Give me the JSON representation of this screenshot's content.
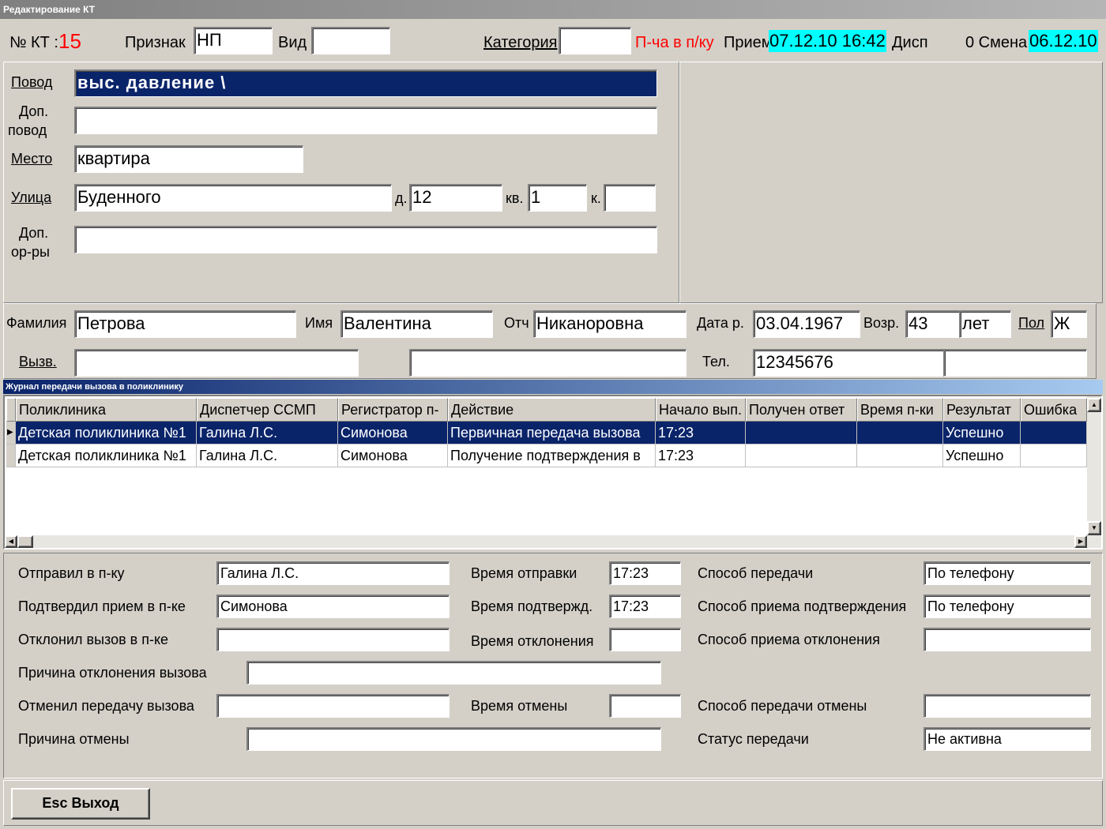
{
  "window": {
    "title": "Редактирование КТ"
  },
  "header": {
    "kt_label": "№ КТ :",
    "kt_number": "15",
    "priznak_label": "Признак",
    "priznak_value": "НП",
    "vid_label": "Вид",
    "vid_value": "",
    "kategoriya_label": "Категория",
    "kategoriya_value": "",
    "pcha_label": "П-ча в п/ку",
    "priem_label": "Прием",
    "priem_value": "07.12.10 16:42",
    "disp_label": "Дисп",
    "smena_label": "0 Смена",
    "smena_value": "06.12.10"
  },
  "address": {
    "povod_label": "Повод",
    "povod_value": "выс. давление  \\",
    "dop_povod_label_1": "Доп.",
    "dop_povod_label_2": "повод",
    "dop_povod_value": "",
    "mesto_label": "Место",
    "mesto_value": "квартира",
    "ulica_label": "Улица",
    "ulica_value": "Буденного",
    "d_label": "д.",
    "d_value": "12",
    "kv_label": "кв.",
    "kv_value": "1",
    "k_label": "к.",
    "k_value": "",
    "dop_ory_label_1": "Доп.",
    "dop_ory_label_2": "ор-ры",
    "dop_ory_value": ""
  },
  "patient": {
    "familiya_label": "Фамилия",
    "familiya_value": "Петрова",
    "imya_label": "Имя",
    "imya_value": "Валентина",
    "otch_label": "Отч",
    "otch_value": "Никаноровна",
    "data_r_label": "Дата р.",
    "data_r_value": "03.04.1967",
    "vozr_label": "Возр.",
    "vozr_value": "43",
    "vozr_unit": "лет",
    "pol_label": "Пол",
    "pol_value": "Ж",
    "vyzv_label": "Вызв.",
    "vyzv_value": "",
    "vyzv_value2": "",
    "tel_label": "Тел.",
    "tel_value": "12345676",
    "tel_value2": ""
  },
  "journal": {
    "title": "Журнал передачи вызова в поликлинику",
    "columns": [
      "Поликлиника",
      "Диспетчер ССМП",
      "Регистратор п-",
      "Действие",
      "Начало вып.",
      "Получен ответ",
      "Время п-ки",
      "Результат",
      "Ошибка"
    ],
    "rows": [
      [
        "Детская поликлиника №1",
        "Галина Л.С.",
        "Симонова",
        "Первичная передача вызова",
        "17:23",
        "",
        "",
        "Успешно",
        ""
      ],
      [
        "Детская поликлиника №1",
        "Галина Л.С.",
        "Симонова",
        "Получение подтверждения в",
        "17:23",
        "",
        "",
        "Успешно",
        ""
      ]
    ]
  },
  "details": {
    "otpravil_label": "Отправил в п-ку",
    "otpravil_value": "Галина Л.С.",
    "vremya_otpr_label": "Время отправки",
    "vremya_otpr_value": "17:23",
    "sposob_per_label": "Способ передачи",
    "sposob_per_value": "По телефону",
    "podtverdil_label": "Подтвердил прием в п-ке",
    "podtverdil_value": "Симонова",
    "vremya_podtv_label": "Время подтвержд.",
    "vremya_podtv_value": "17:23",
    "sposob_podtv_label": "Способ приема подтверждения",
    "sposob_podtv_value": "По телефону",
    "otklonil_label": "Отклонил вызов в п-ке",
    "otklonil_value": "",
    "vremya_otkl_label": "Время отклонения",
    "vremya_otkl_value": "",
    "sposob_otkl_label": "Способ приема отклонения",
    "sposob_otkl_value": "",
    "prichina_otkl_label": "Причина отклонения вызова",
    "prichina_otkl_value": "",
    "otmenil_label": "Отменил передачу вызова",
    "otmenil_value": "",
    "vremya_otm_label": "Время отмены",
    "vremya_otm_value": "",
    "sposob_otm_label": "Способ передачи отмены",
    "sposob_otm_value": "",
    "prichina_otm_label": "Причина отмены",
    "prichina_otm_value": "",
    "status_label": "Статус передачи",
    "status_value": "Не активна"
  },
  "footer": {
    "exit_label": "Esc Выход"
  },
  "colors": {
    "accent": "#0a246a",
    "highlight": "#00ffff",
    "red": "#ff0000"
  }
}
